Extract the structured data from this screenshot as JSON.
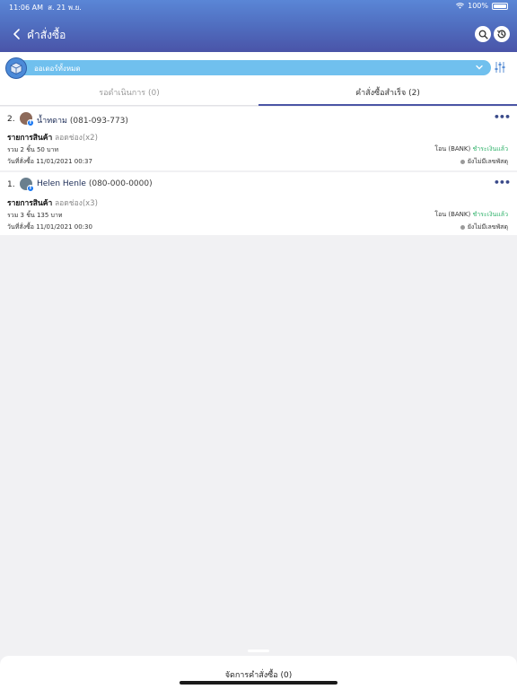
{
  "status_bar": {
    "time": "11:06 AM",
    "date": "ส. 21 พ.ย.",
    "battery": "100%"
  },
  "header": {
    "title": "คำสั่งซื้อ"
  },
  "filter": {
    "label": "ออเดอร์ทั้งหมด"
  },
  "tabs": [
    {
      "label": "รอดำเนินการ (0)",
      "active": false
    },
    {
      "label": "คำสั่งซื้อสำเร็จ (2)",
      "active": true
    }
  ],
  "orders": [
    {
      "number": "2.",
      "customer_name": "น้ำทดาม",
      "phone": "(081-093-773)",
      "items_label": "รายการสินค้า",
      "items_value": "ลอดช่อง(x2)",
      "total": "รวม 2 ชิ้น 50 บาท",
      "payment_method": "โอน (BANK)",
      "payment_status": "ชำระเงินแล้ว",
      "date": "วันที่สั่งซื้อ 11/01/2021 00:37",
      "tracking": "ยังไม่มีเลขพัสดุ"
    },
    {
      "number": "1.",
      "customer_name": "Helen Henle",
      "phone": "(080-000-0000)",
      "items_label": "รายการสินค้า",
      "items_value": "ลอดช่อง(x3)",
      "total": "รวม 3 ชิ้น 135 บาท",
      "payment_method": "โอน (BANK)",
      "payment_status": "ชำระเงินแล้ว",
      "date": "วันที่สั่งซื้อ 11/01/2021 00:30",
      "tracking": "ยังไม่มีเลขพัสดุ"
    }
  ],
  "bottom": {
    "manage_label": "จัดการคำสั่งซื้อ (0)"
  },
  "colors": {
    "header_top": "#5a86d6",
    "header_bottom": "#4a54a8",
    "filter_bar": "#70c0ee",
    "paid": "#2fb26a",
    "tab_indicator": "#4a55a5"
  }
}
